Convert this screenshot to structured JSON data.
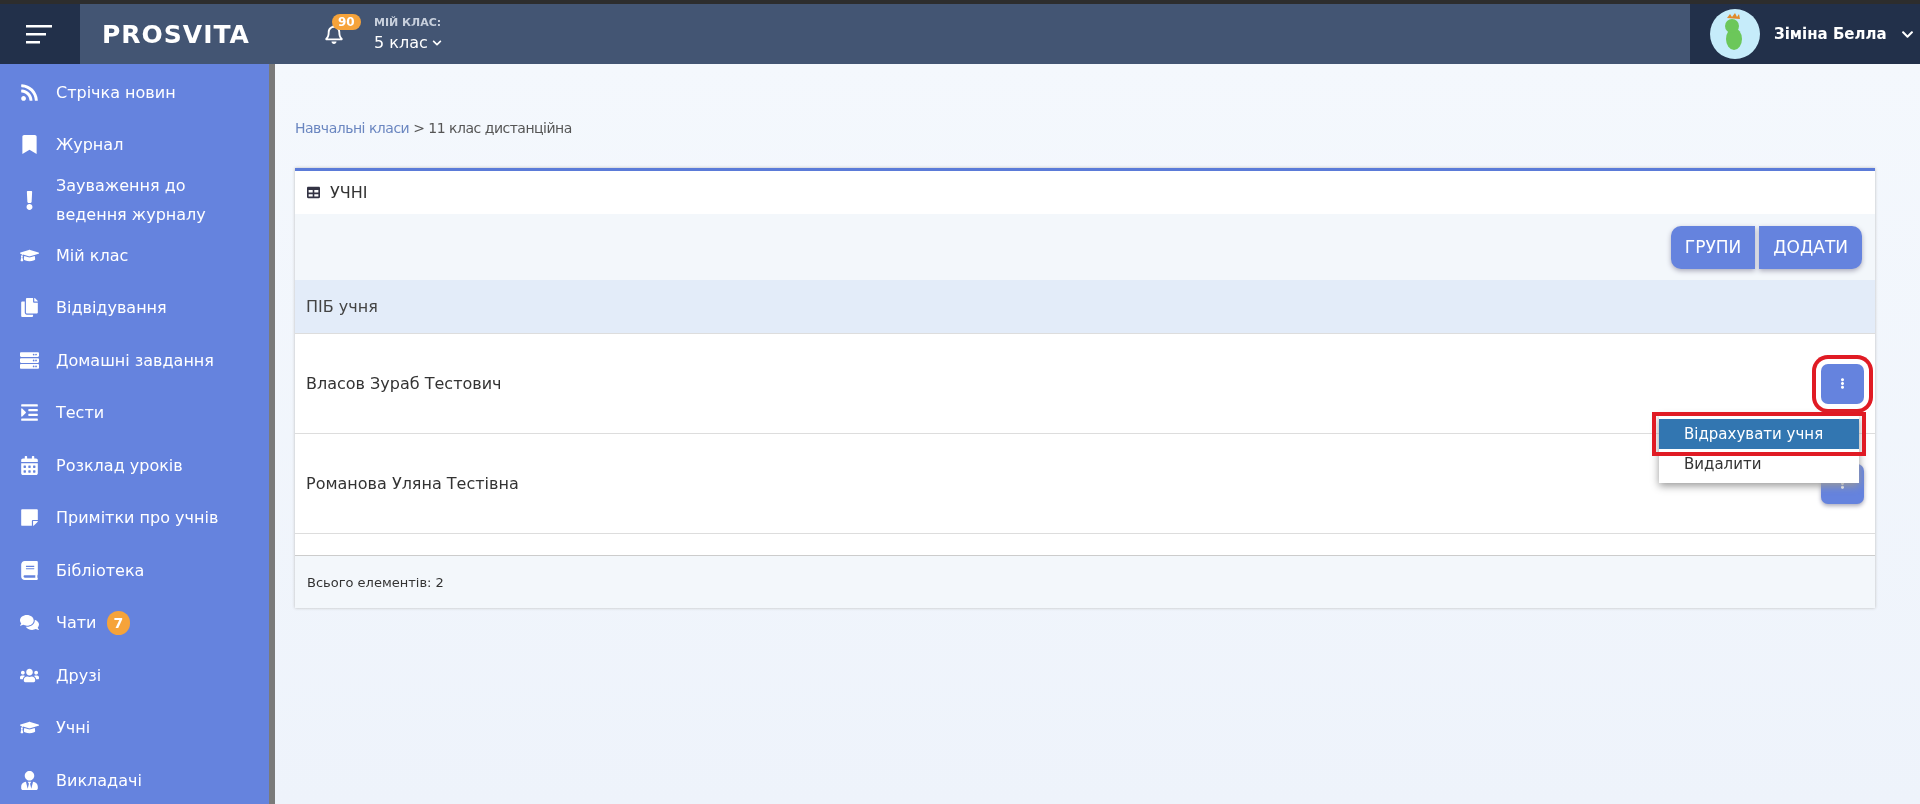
{
  "header": {
    "logo": "PROSVITA",
    "notifications": "90",
    "class_label": "МІЙ КЛАС:",
    "class_value": "5 клас",
    "user": "Зіміна Белла"
  },
  "sidebar": {
    "items": [
      {
        "label": "Стрічка новин"
      },
      {
        "label": "Журнал"
      },
      {
        "label": "Зауваження до ведення журналу"
      },
      {
        "label": "Мій клас"
      },
      {
        "label": "Відвідування"
      },
      {
        "label": "Домашні завдання"
      },
      {
        "label": "Тести"
      },
      {
        "label": "Розклад уроків"
      },
      {
        "label": "Примітки про учнів"
      },
      {
        "label": "Бібліотека"
      },
      {
        "label": "Чати",
        "badge": "7"
      },
      {
        "label": "Друзі"
      },
      {
        "label": "Учні"
      },
      {
        "label": "Викладачі"
      }
    ]
  },
  "breadcrumb": {
    "link": "Навчальні класи",
    "separator": ">",
    "current": "11 клас дистанційна"
  },
  "panel": {
    "title": "УЧНІ",
    "buttons": [
      "ГРУПИ",
      "ДОДАТИ"
    ],
    "table": {
      "columns": [
        "ПІБ учня"
      ],
      "rows": [
        {
          "name": "Власов Зураб Тестович",
          "menu_open": true,
          "marked": true,
          "menu": [
            {
              "label": "Відрахувати учня",
              "selected": true,
              "marked": true
            },
            {
              "label": "Видалити",
              "selected": false,
              "marked": false
            }
          ]
        },
        {
          "name": "Романова Уляна Тестівна",
          "menu_open": false,
          "marked": false,
          "menu": []
        }
      ]
    },
    "footer": "Всього елементів: 2"
  }
}
